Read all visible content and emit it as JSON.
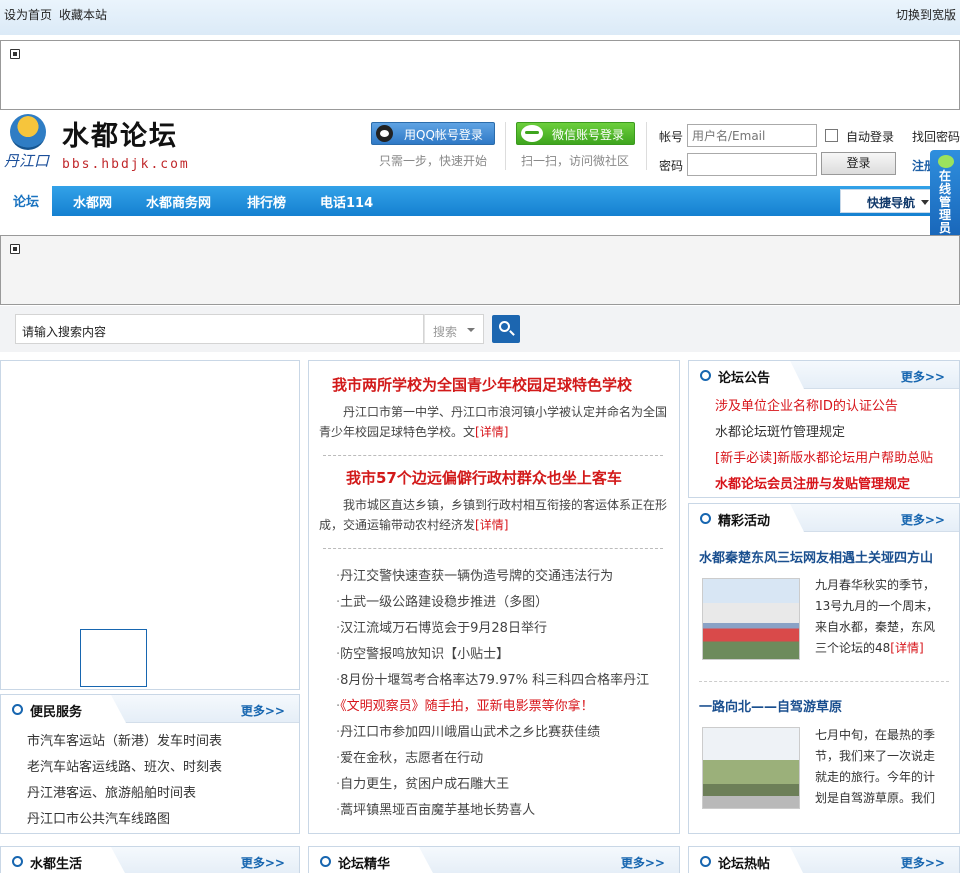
{
  "topbar": {
    "set_home": "设为首页",
    "bookmark": "收藏本站",
    "switch_wide": "切换到宽版"
  },
  "logo": {
    "title": "水都论坛",
    "script": "丹江口",
    "url": "bbs.hbdjk.com"
  },
  "social": {
    "qq_label": "用QQ帐号登录",
    "qq_hint": "只需一步，快速开始",
    "wechat_label": "微信账号登录",
    "wechat_hint": "扫一扫，访问微社区"
  },
  "login": {
    "account_label": "帐号",
    "account_placeholder": "用户名/Email",
    "password_label": "密码",
    "auto_login": "自动登录",
    "login_button": "登录",
    "find_password": "找回密码",
    "register": "注册"
  },
  "nav": {
    "tabs": [
      "论坛",
      "水都网",
      "水都商务网",
      "排行榜",
      "电话114"
    ],
    "quick_nav": "快捷导航"
  },
  "online_admin": "在线管理员",
  "search": {
    "placeholder": "请输入搜索内容",
    "type_label": "搜索"
  },
  "center": {
    "headline1": "我市两所学校为全国青少年校园足球特色学校",
    "summary1": "丹江口市第一中学、丹江口市浪河镇小学被认定并命名为全国青少年校园足球特色学校。文",
    "headline2": "我市57个边远偏僻行政村群众也坐上客车",
    "summary2": "我市城区直达乡镇，乡镇到行政村相互衔接的客运体系正在形成，交通运输带动农村经济发",
    "detail": "[详情]",
    "news": [
      "丹江交警快速查获一辆伪造号牌的交通违法行为",
      "土武一级公路建设稳步推进（多图）",
      "汉江流域万石博览会于9月28日举行",
      "防空警报鸣放知识【小贴士】",
      "8月份十堰驾考合格率达79.97% 科三科四合格率丹江",
      "《文明观察员》随手拍，亚新电影票等你拿！",
      "丹江口市参加四川峨眉山武术之乡比赛获佳绩",
      "爱在金秋，志愿者在行动",
      "自力更生，贫困户成石雕大王",
      "蒿坪镇黑垭百亩魔芋基地长势喜人"
    ],
    "news_colors": {
      "highlight": "#d7141a"
    }
  },
  "services": {
    "title": "便民服务",
    "more": "更多>>",
    "items": [
      "市汽车客运站（新港）发车时间表",
      "老汽车站客运线路、班次、时刻表",
      "丹江港客运、旅游船舶时间表",
      "丹江口市公共汽车线路图"
    ]
  },
  "announcements": {
    "title": "论坛公告",
    "more": "更多>>",
    "items": [
      "涉及单位企业名称ID的认证公告",
      "水都论坛斑竹管理规定",
      "[新手必读]新版水都论坛用户帮助总贴",
      "水都论坛会员注册与发贴管理规定"
    ]
  },
  "activities": {
    "title": "精彩活动",
    "more": "更多>>",
    "items": [
      {
        "title": "水都秦楚东风三坛网友相遇土关垭四方山",
        "text": "九月春华秋实的季节，13号九月的一个周末，来自水都，秦楚，东风三个论坛的48"
      },
      {
        "title": "一路向北——自驾游草原",
        "text": "七月中旬，在最热的季节，我们来了一次说走就走的旅行。今年的计划是自驾游草原。我们"
      }
    ]
  },
  "bottom": {
    "life": "水都生活",
    "essence": "论坛精华",
    "hot": "论坛热帖",
    "more": "更多>>"
  }
}
